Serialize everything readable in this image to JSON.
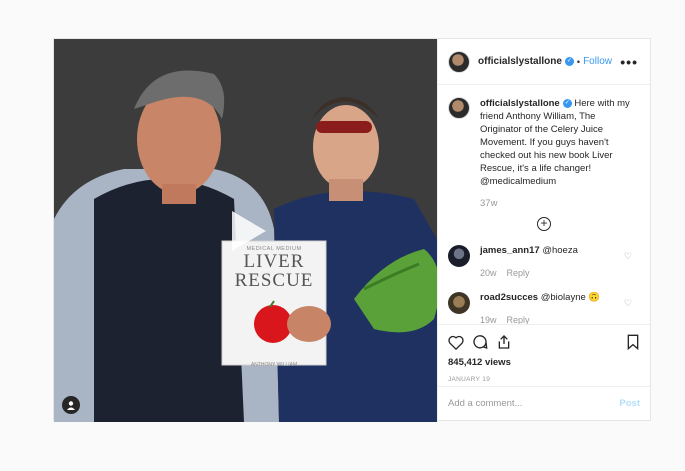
{
  "header": {
    "username": "officialslystallone",
    "separator": "•",
    "follow_label": "Follow",
    "more_label": "•••"
  },
  "caption": {
    "username": "officialslystallone",
    "text": " Here with my friend Anthony William, The Originator of the Celery Juice Movement. If you guys haven't checked out his new book Liver Rescue, it's a life changer! @medicalmedium",
    "time": "37w"
  },
  "comments": [
    {
      "username": "james_ann17",
      "text": "@hoeza",
      "time": "20w",
      "reply": "Reply"
    },
    {
      "username": "road2succes",
      "text": "@biolayne 🙃",
      "time": "19w",
      "reply": "Reply"
    }
  ],
  "book": {
    "top_text": "MEDICAL MEDIUM",
    "title_line1": "LIVER",
    "title_line2": "RESCUE",
    "author": "ANTHONY WILLIAM"
  },
  "stats": {
    "views": "845,412 views",
    "date": "JANUARY 19"
  },
  "comment_box": {
    "placeholder": "Add a comment...",
    "post_label": "Post"
  },
  "icons": [
    "play-icon",
    "user-tag-icon",
    "verified-icon",
    "more-icon",
    "add-icon",
    "heart-icon",
    "comment-icon",
    "share-icon",
    "save-icon"
  ],
  "colors": {
    "accent": "#3897f0",
    "muted": "#999999",
    "border": "#efefef"
  }
}
